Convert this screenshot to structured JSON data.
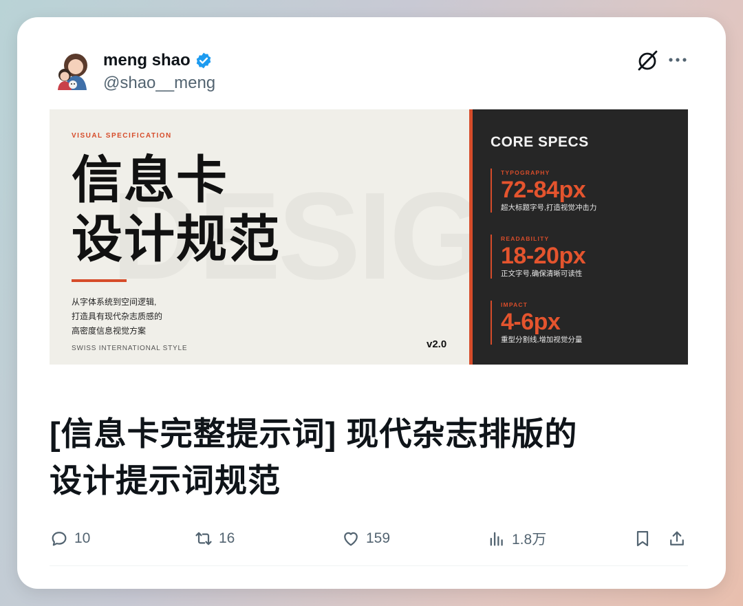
{
  "author": {
    "name": "meng shao",
    "handle": "@shao__meng",
    "verified_color": "#1d9bf0"
  },
  "info_card": {
    "kicker": "VISUAL SPECIFICATION",
    "title_line1": "信息卡",
    "title_line2": "设计规范",
    "background_word": "DESIGN",
    "description": [
      "从字体系统到空间逻辑,",
      "打造具有现代杂志质感的",
      "高密度信息视觉方案"
    ],
    "style_label": "SWISS INTERNATIONAL STYLE",
    "version": "v2.0",
    "accent_color": "#d64c2a",
    "core_title": "CORE SPECS",
    "specs": [
      {
        "label": "TYPOGRAPHY",
        "value": "72-84px",
        "desc": "超大标题字号,打造视觉冲击力"
      },
      {
        "label": "READABILITY",
        "value": "18-20px",
        "desc": "正文字号,确保清晰可读性"
      },
      {
        "label": "IMPACT",
        "value": "4-6px",
        "desc": "重型分割线,增加视觉分量"
      }
    ]
  },
  "tweet_text_line1": "[信息卡完整提示词] 现代杂志排版的",
  "tweet_text_line2": "设计提示词规范",
  "actions": {
    "replies": "10",
    "retweets": "16",
    "likes": "159",
    "views": "1.8万"
  },
  "icons": [
    "grok-icon",
    "more-icon",
    "reply-icon",
    "retweet-icon",
    "like-icon",
    "views-icon",
    "bookmark-icon",
    "share-icon"
  ]
}
